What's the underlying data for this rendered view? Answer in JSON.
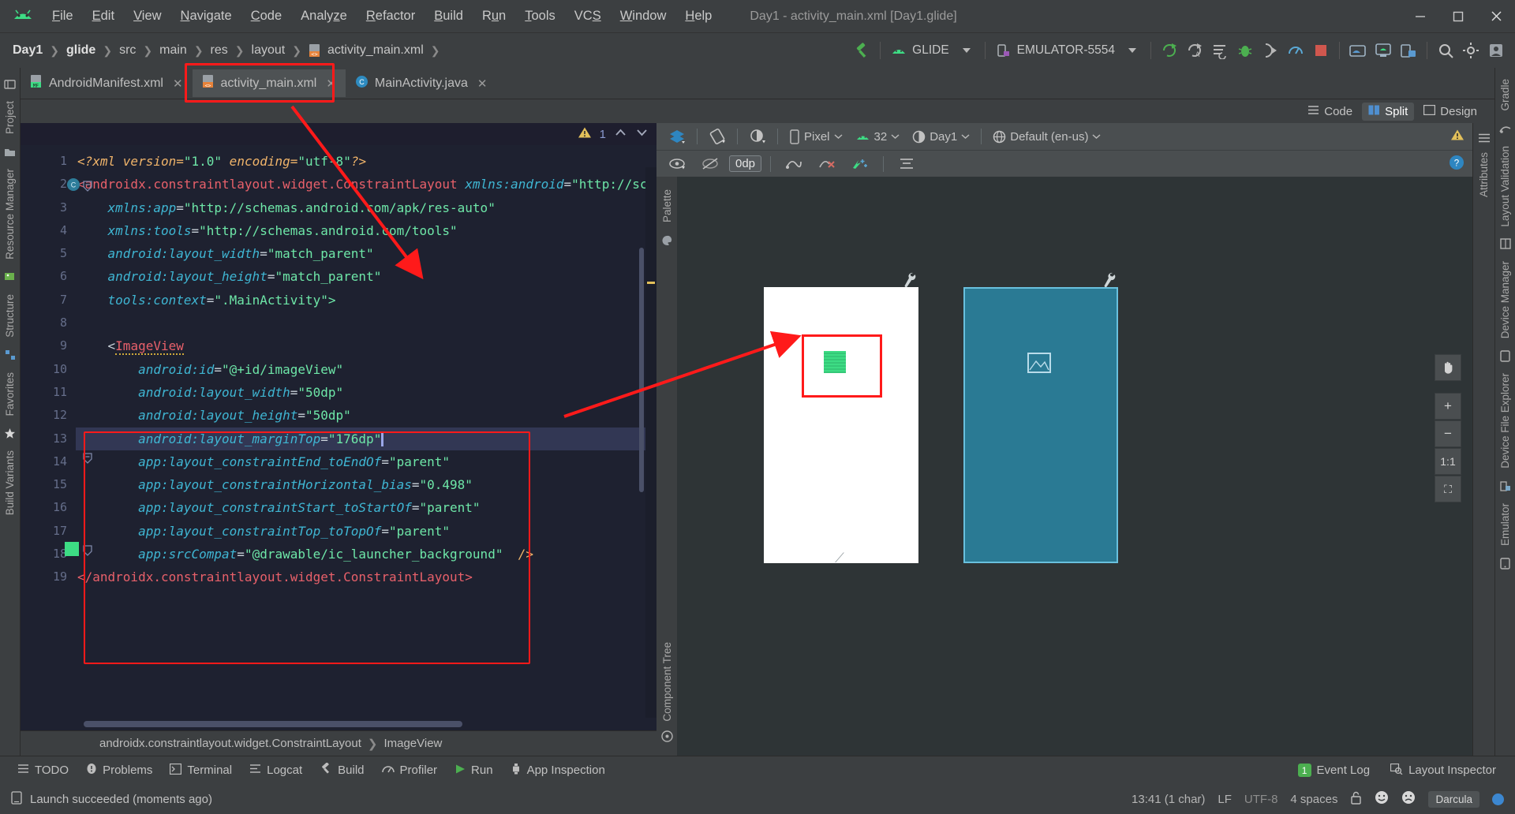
{
  "window": {
    "title": "Day1 - activity_main.xml [Day1.glide]",
    "minimize": "—",
    "maximize": "▢",
    "close": "✕"
  },
  "menu": [
    "File",
    "Edit",
    "View",
    "Navigate",
    "Code",
    "Analyze",
    "Refactor",
    "Build",
    "Run",
    "Tools",
    "VCS",
    "Window",
    "Help"
  ],
  "breadcrumb_top": [
    "Day1",
    "glide",
    "src",
    "main",
    "res",
    "layout",
    "activity_main.xml"
  ],
  "toolbar": {
    "run_config": "GLIDE",
    "device": "EMULATOR-5554"
  },
  "tabs": [
    {
      "label": "AndroidManifest.xml",
      "icon": "xml-manifest-icon",
      "active": false
    },
    {
      "label": "activity_main.xml",
      "icon": "xml-layout-icon",
      "active": true
    },
    {
      "label": "MainActivity.java",
      "icon": "java-class-icon",
      "active": false
    }
  ],
  "editor_modes": [
    {
      "label": "Code",
      "selected": false
    },
    {
      "label": "Split",
      "selected": true
    },
    {
      "label": "Design",
      "selected": false
    }
  ],
  "editor": {
    "warning_count": "1",
    "lines": [
      {
        "n": "1",
        "tokens": [
          {
            "t": "<?",
            "c": "k-pi"
          },
          {
            "t": "xml ",
            "c": "k-pi"
          },
          {
            "t": "version",
            "c": "k-pi"
          },
          {
            "t": "=",
            "c": "k-pi"
          },
          {
            "t": "\"1.0\"",
            "c": "k-val"
          },
          {
            "t": " encoding",
            "c": "k-pi"
          },
          {
            "t": "=",
            "c": "k-pi"
          },
          {
            "t": "\"utf-8\"",
            "c": "k-val"
          },
          {
            "t": "?>",
            "c": "k-pi"
          }
        ],
        "indent": 0
      },
      {
        "n": "2",
        "tokens": [
          {
            "t": "<androidx.constraintlayout.widget.ConstraintLayout ",
            "c": "k-tag"
          },
          {
            "t": "xmlns:android",
            "c": "k-attr"
          },
          {
            "t": "=",
            "c": "k-punct"
          },
          {
            "t": "\"http://schema",
            "c": "k-val"
          }
        ],
        "indent": 0
      },
      {
        "n": "3",
        "tokens": [
          {
            "t": "xmlns:app",
            "c": "k-attr"
          },
          {
            "t": "=",
            "c": "k-punct"
          },
          {
            "t": "\"http://schemas.android.com/apk/res-auto\"",
            "c": "k-val"
          }
        ],
        "indent": 4
      },
      {
        "n": "4",
        "tokens": [
          {
            "t": "xmlns:tools",
            "c": "k-attr"
          },
          {
            "t": "=",
            "c": "k-punct"
          },
          {
            "t": "\"http://schemas.android.com/tools\"",
            "c": "k-val"
          }
        ],
        "indent": 4
      },
      {
        "n": "5",
        "tokens": [
          {
            "t": "android:layout_width",
            "c": "k-attr"
          },
          {
            "t": "=",
            "c": "k-punct"
          },
          {
            "t": "\"match_parent\"",
            "c": "k-val"
          }
        ],
        "indent": 4
      },
      {
        "n": "6",
        "tokens": [
          {
            "t": "android:layout_height",
            "c": "k-attr"
          },
          {
            "t": "=",
            "c": "k-punct"
          },
          {
            "t": "\"match_parent\"",
            "c": "k-val"
          }
        ],
        "indent": 4
      },
      {
        "n": "7",
        "tokens": [
          {
            "t": "tools:context",
            "c": "k-attr"
          },
          {
            "t": "=",
            "c": "k-punct"
          },
          {
            "t": "\".MainActivity\">",
            "c": "k-val"
          }
        ],
        "indent": 4
      },
      {
        "n": "8",
        "tokens": [],
        "indent": 4
      },
      {
        "n": "9",
        "tokens": [
          {
            "t": "<",
            "c": "k-punct"
          },
          {
            "t": "ImageView",
            "c": "k-name squig"
          }
        ],
        "indent": 4
      },
      {
        "n": "10",
        "tokens": [
          {
            "t": "android:id",
            "c": "k-attr"
          },
          {
            "t": "=",
            "c": "k-punct"
          },
          {
            "t": "\"@+id/imageView\"",
            "c": "k-val"
          }
        ],
        "indent": 8
      },
      {
        "n": "11",
        "tokens": [
          {
            "t": "android:layout_width",
            "c": "k-attr"
          },
          {
            "t": "=",
            "c": "k-punct"
          },
          {
            "t": "\"50dp\"",
            "c": "k-val"
          }
        ],
        "indent": 8
      },
      {
        "n": "12",
        "tokens": [
          {
            "t": "android:layout_height",
            "c": "k-attr"
          },
          {
            "t": "=",
            "c": "k-punct"
          },
          {
            "t": "\"50dp\"",
            "c": "k-val"
          }
        ],
        "indent": 8
      },
      {
        "n": "13",
        "tokens": [
          {
            "t": "android:layout_marginTop",
            "c": "k-attr"
          },
          {
            "t": "=",
            "c": "k-punct"
          },
          {
            "t": "\"176dp\"",
            "c": "k-val"
          }
        ],
        "indent": 8,
        "highlight": true,
        "caret": true
      },
      {
        "n": "14",
        "tokens": [
          {
            "t": "app:layout_constraintEnd_toEndOf",
            "c": "k-attr"
          },
          {
            "t": "=",
            "c": "k-punct"
          },
          {
            "t": "\"parent\"",
            "c": "k-val"
          }
        ],
        "indent": 8
      },
      {
        "n": "15",
        "tokens": [
          {
            "t": "app:layout_constraintHorizontal_bias",
            "c": "k-attr"
          },
          {
            "t": "=",
            "c": "k-punct"
          },
          {
            "t": "\"0.498\"",
            "c": "k-val"
          }
        ],
        "indent": 8
      },
      {
        "n": "16",
        "tokens": [
          {
            "t": "app:layout_constraintStart_toStartOf",
            "c": "k-attr"
          },
          {
            "t": "=",
            "c": "k-punct"
          },
          {
            "t": "\"parent\"",
            "c": "k-val"
          }
        ],
        "indent": 8
      },
      {
        "n": "17",
        "tokens": [
          {
            "t": "app:layout_constraintTop_toTopOf",
            "c": "k-attr"
          },
          {
            "t": "=",
            "c": "k-punct"
          },
          {
            "t": "\"parent\"",
            "c": "k-val"
          }
        ],
        "indent": 8
      },
      {
        "n": "18",
        "tokens": [
          {
            "t": "app:srcCompat",
            "c": "k-attr"
          },
          {
            "t": "=",
            "c": "k-punct"
          },
          {
            "t": "\"@drawable/ic_launcher_background\"",
            "c": "k-val"
          },
          {
            "t": "  />",
            "c": "k-dec"
          }
        ],
        "indent": 8
      },
      {
        "n": "19",
        "tokens": [
          {
            "t": "</androidx.constraintlayout.widget.ConstraintLayout>",
            "c": "k-tag"
          }
        ],
        "indent": 0
      }
    ]
  },
  "editor_breadcrumb": [
    "androidx.constraintlayout.widget.ConstraintLayout",
    "ImageView"
  ],
  "design": {
    "toolbar": {
      "device": "Pixel",
      "api": "32",
      "theme": "Day1",
      "locale": "Default (en-us)",
      "margin_value": "0dp"
    },
    "zoom_controls": [
      "+",
      "−",
      "1:1",
      "⛶"
    ],
    "pan_icon": "hand-pan-icon"
  },
  "left_strip": [
    "Project",
    "Resource Manager",
    "Structure",
    "Favorites",
    "Build Variants"
  ],
  "right_strip": [
    "Gradle",
    "Layout Validation",
    "Device Manager",
    "Device File Explorer",
    "Emulator"
  ],
  "palette_label": "Palette",
  "component_tree_label": "Component Tree",
  "attributes_label": "Attributes",
  "bottom_tools": [
    {
      "label": "TODO",
      "icon": "list-icon"
    },
    {
      "label": "Problems",
      "icon": "problems-icon"
    },
    {
      "label": "Terminal",
      "icon": "terminal-icon"
    },
    {
      "label": "Logcat",
      "icon": "logcat-icon"
    },
    {
      "label": "Build",
      "icon": "hammer-icon"
    },
    {
      "label": "Profiler",
      "icon": "profiler-icon"
    },
    {
      "label": "Run",
      "icon": "run-icon"
    },
    {
      "label": "App Inspection",
      "icon": "inspection-icon"
    }
  ],
  "bottom_right_tools": [
    {
      "label": "Event Log",
      "badge": "1",
      "icon": "event-log-icon"
    },
    {
      "label": "Layout Inspector",
      "icon": "layout-inspector-icon"
    }
  ],
  "status": {
    "message": "Launch succeeded (moments ago)",
    "position": "13:41 (1 char)",
    "line_sep": "LF",
    "encoding": "UTF-8",
    "indent": "4 spaces",
    "theme": "Darcula"
  },
  "colors": {
    "accent_red": "#ff1a1a",
    "android_green": "#3ddc84",
    "blue_select": "#3c87d0"
  }
}
